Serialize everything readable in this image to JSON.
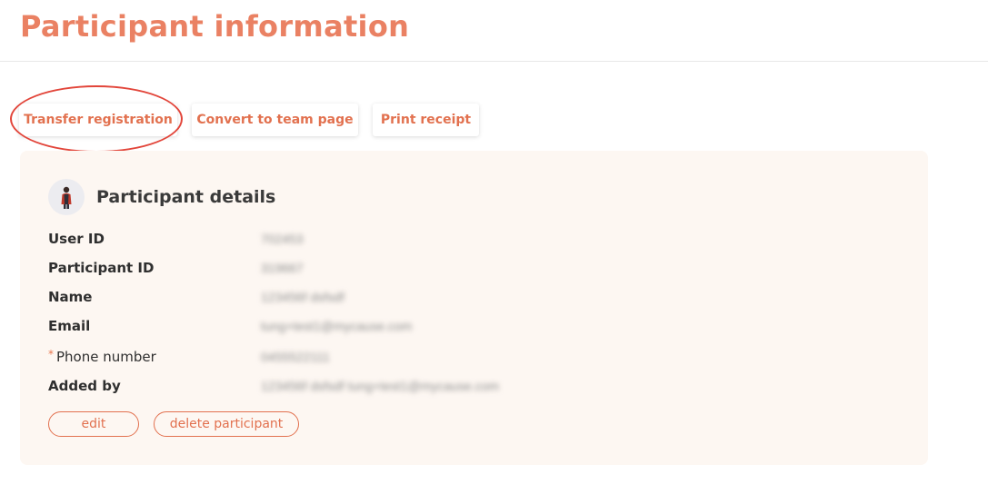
{
  "page": {
    "title": "Participant information"
  },
  "actions": {
    "transfer_label": "Transfer registration",
    "convert_label": "Convert to team page",
    "print_label": "Print receipt"
  },
  "details": {
    "title": "Participant details",
    "avatar_icon": "person-avatar-icon",
    "fields": [
      {
        "label": "User ID",
        "value": "702453"
      },
      {
        "label": "Participant ID",
        "value": "319667"
      },
      {
        "label": "Name",
        "value": "123456f dsfsdf"
      },
      {
        "label": "Email",
        "value": "tung+test1@mycause.com"
      },
      {
        "label": "Phone number",
        "value": "0455522111",
        "required_marker": "*"
      },
      {
        "label": "Added by",
        "value": "123456f dsfsdf tung+test1@mycause.com"
      }
    ],
    "edit_label": "edit",
    "delete_label": "delete participant"
  },
  "colors": {
    "accent": "#ea8163",
    "button_text": "#e2714f",
    "highlight": "#e2453a",
    "card_background": "#fdf7f2"
  }
}
